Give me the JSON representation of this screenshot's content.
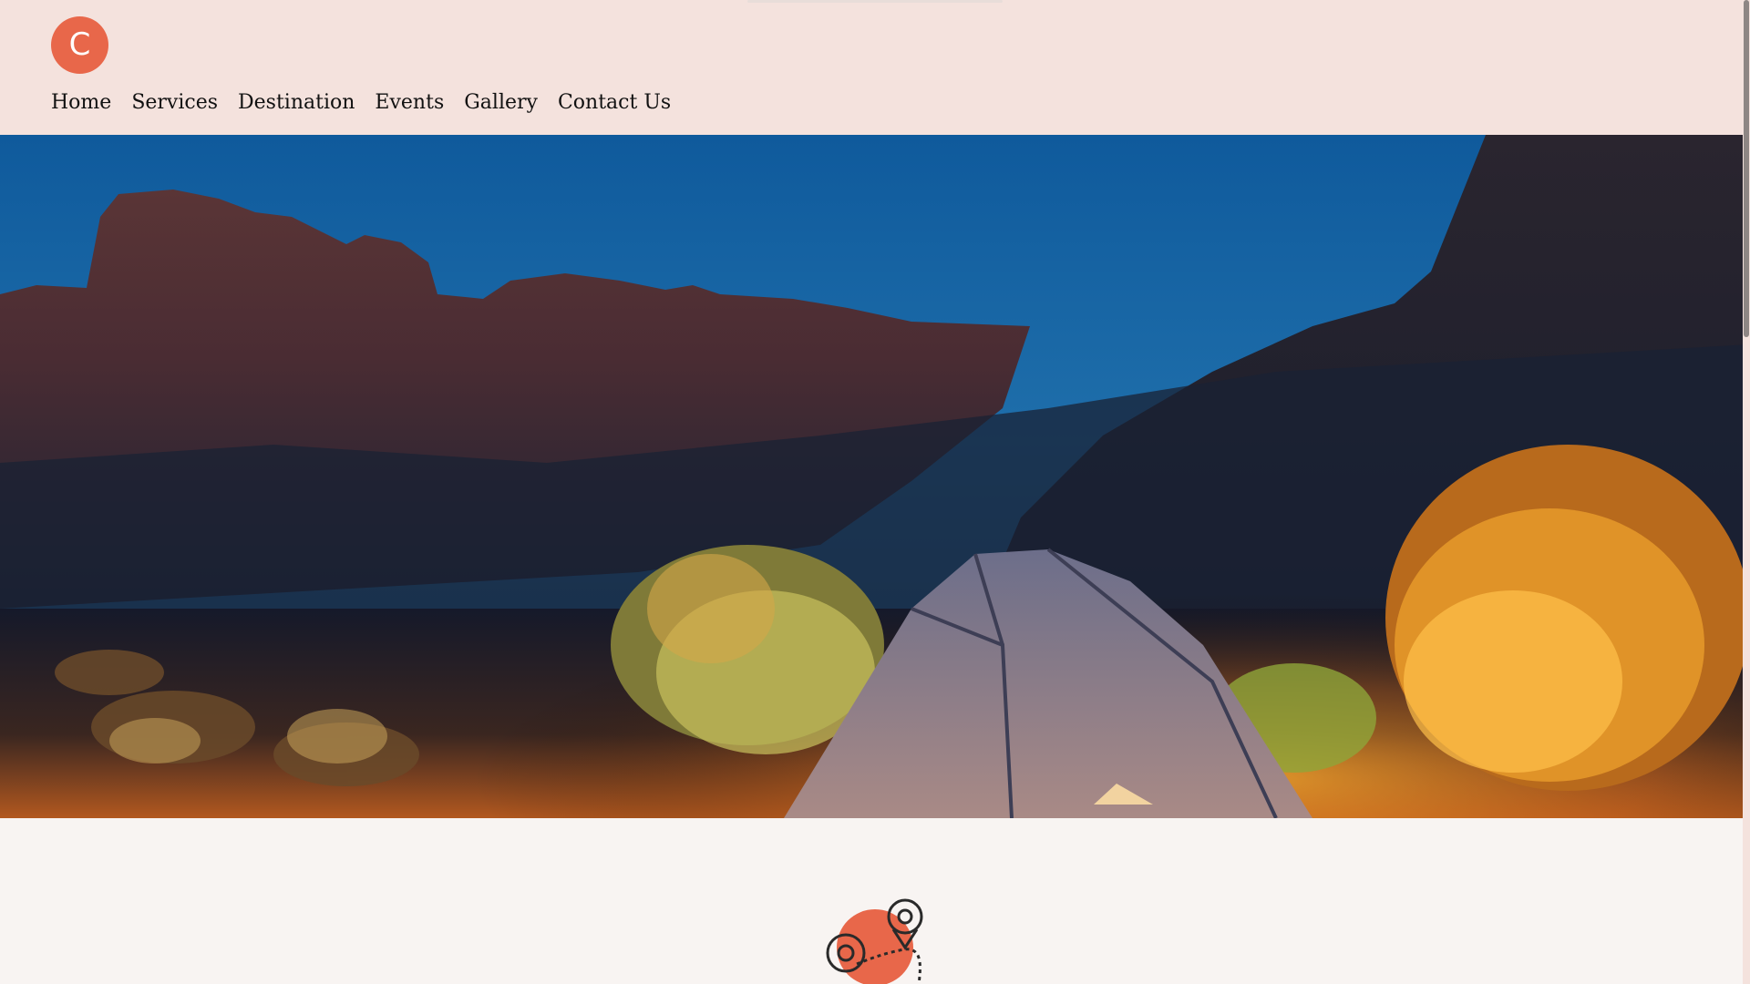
{
  "header": {
    "logo_letter": "C"
  },
  "nav": {
    "items": [
      "Home",
      "Services",
      "Destination",
      "Events",
      "Gallery",
      "Contact Us"
    ]
  },
  "colors": {
    "header_bg": "#f4e2dd",
    "accent": "#e8674a",
    "page_bg": "#f8f4f2"
  },
  "icons": {
    "section_icon": "map-route-pin-icon"
  }
}
